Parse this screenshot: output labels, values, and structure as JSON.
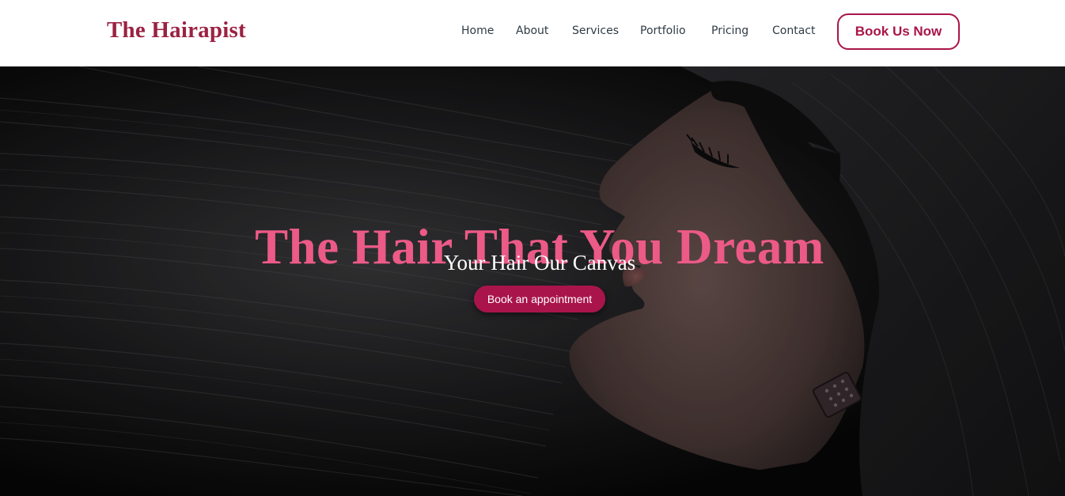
{
  "brand": {
    "name": "The Hairapist",
    "color": "#9b2242"
  },
  "nav": {
    "links": [
      {
        "label": "Home"
      },
      {
        "label": "About"
      },
      {
        "label": "Services"
      },
      {
        "label": "Portfolio"
      },
      {
        "label": "Pricing"
      },
      {
        "label": "Contact"
      }
    ],
    "cta_label": "Book Us Now",
    "accent": "#a9154a"
  },
  "hero": {
    "title": "The Hair That You Dream",
    "subtitle": "Your Hair Our Canvas",
    "cta_label": "Book an appointment",
    "title_color": "#ec5a87",
    "image": "woman-long-black-hair-profile-photo"
  }
}
